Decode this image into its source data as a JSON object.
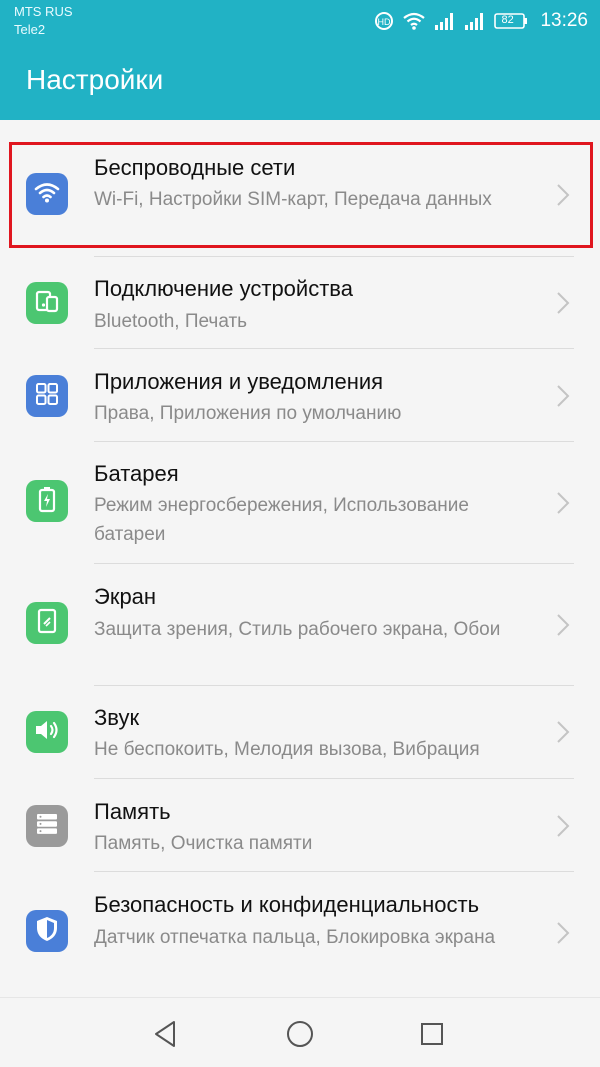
{
  "status_bar": {
    "carrier_1": "MTS RUS",
    "carrier_2": "Tele2",
    "time": "13:26",
    "battery_level": "82",
    "icons": [
      "hd-call-icon",
      "wifi-icon",
      "signal-icon",
      "signal-icon",
      "battery-icon"
    ]
  },
  "app_bar": {
    "title": "Настройки"
  },
  "settings": [
    {
      "title": "Беспроводные сети",
      "subtitle": "Wi-Fi, Настройки SIM-карт, Передача данных",
      "icon": "wifi-icon",
      "color": "#4a7fd8",
      "highlighted": true
    },
    {
      "title": "Подключение устройства",
      "subtitle": "Bluetooth, Печать",
      "icon": "device-connection-icon",
      "color": "#4cc671"
    },
    {
      "title": "Приложения и уведомления",
      "subtitle": "Права, Приложения по умолчанию",
      "icon": "apps-grid-icon",
      "color": "#4a7fd8"
    },
    {
      "title": "Батарея",
      "subtitle": "Режим энергосбережения, Использование батареи",
      "icon": "battery-icon",
      "color": "#4cc671"
    },
    {
      "title": "Экран",
      "subtitle": "Защита зрения, Стиль рабочего экрана, Обои",
      "icon": "display-icon",
      "color": "#4cc671"
    },
    {
      "title": "Звук",
      "subtitle": "Не беспокоить, Мелодия вызова, Вибрация",
      "icon": "speaker-icon",
      "color": "#4cc671"
    },
    {
      "title": "Память",
      "subtitle": "Память, Очистка памяти",
      "icon": "storage-icon",
      "color": "#9a9a9a"
    },
    {
      "title": "Безопасность и конфиденциальность",
      "subtitle": "Датчик отпечатка пальца, Блокировка экрана",
      "icon": "shield-icon",
      "color": "#4a7fd8"
    }
  ],
  "nav_bar": {
    "buttons": [
      "back-icon",
      "home-icon",
      "recents-icon"
    ]
  },
  "colors": {
    "accent": "#21b2c5",
    "highlight_border": "#e0161f"
  }
}
